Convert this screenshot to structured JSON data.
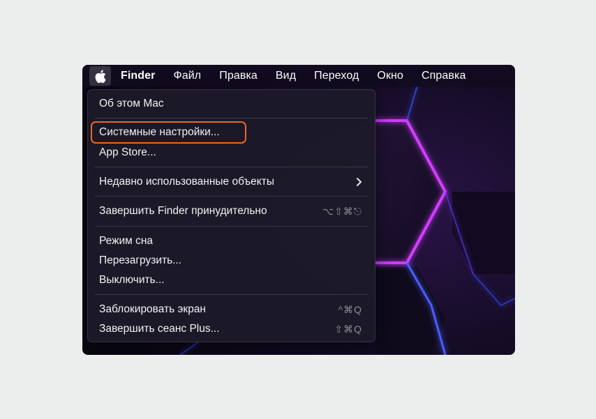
{
  "menubar": {
    "app_name": "Finder",
    "items": [
      "Файл",
      "Правка",
      "Вид",
      "Переход",
      "Окно",
      "Справка"
    ]
  },
  "apple_menu": {
    "items": [
      {
        "label": "Об этом Mac",
        "shortcut": ""
      },
      {
        "label": "Системные настройки...",
        "shortcut": ""
      },
      {
        "label": "App Store...",
        "shortcut": ""
      },
      {
        "label": "Недавно использованные объекты",
        "shortcut": ""
      },
      {
        "label": "Завершить Finder принудительно",
        "shortcut": "⌥⇧⌘⎋"
      },
      {
        "label": "Режим сна",
        "shortcut": ""
      },
      {
        "label": "Перезагрузить...",
        "shortcut": ""
      },
      {
        "label": "Выключить...",
        "shortcut": ""
      },
      {
        "label": "Заблокировать экран",
        "shortcut": "^⌘Q"
      },
      {
        "label": "Завершить сеанс Plus...",
        "shortcut": "⇧⌘Q"
      }
    ],
    "highlighted_item": "Системные настройки..."
  },
  "colors": {
    "highlight": "#f0661c",
    "accent_glow": "#d23cff"
  }
}
